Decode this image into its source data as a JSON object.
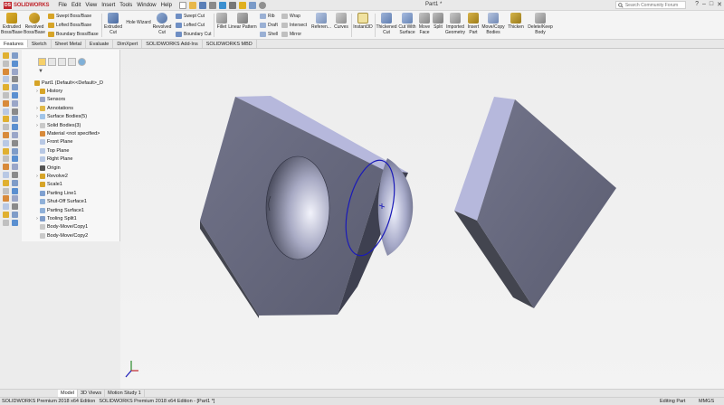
{
  "titlebar": {
    "brand": "SOLIDWORKS",
    "brand_mark": "DS",
    "menus": [
      "File",
      "Edit",
      "View",
      "Insert",
      "Tools",
      "Window",
      "Help"
    ],
    "document_title": "Part1 *",
    "search_placeholder": "Search Community Forum",
    "window_controls": [
      "?",
      "–",
      "□",
      "✕"
    ]
  },
  "ribbon": {
    "extruded_boss": "Extruded Boss/Base",
    "revolved_boss": "Revolved Boss/Base",
    "swept_boss": "Swept Boss/Base",
    "lofted_boss": "Lofted Boss/Base",
    "boundary_boss": "Boundary Boss/Base",
    "extruded_cut": "Extruded Cut",
    "hole_wizard": "Hole Wizard",
    "revolved_cut": "Revolved Cut",
    "swept_cut": "Swept Cut",
    "lofted_cut": "Lofted Cut",
    "boundary_cut": "Boundary Cut",
    "fillet": "Fillet",
    "linear_pattern": "Linear Pattern",
    "rib": "Rib",
    "draft": "Draft",
    "shell": "Shell",
    "wrap": "Wrap",
    "intersect": "Intersect",
    "mirror": "Mirror",
    "reference": "Referen...",
    "curves": "Curves",
    "instant3d": "Instant3D",
    "thickened_cut": "Thickened Cut",
    "cut_with_surface": "Cut With Surface",
    "move_face": "Move Face",
    "split": "Split",
    "imported_geometry": "Imported Geometry",
    "insert_part": "Insert Part",
    "move_copy_bodies": "Move/Copy Bodies",
    "thicken": "Thicken",
    "delete_keep_body": "Delete/Keep Body"
  },
  "cmd_tabs": [
    "Features",
    "Sketch",
    "Sheet Metal",
    "Evaluate",
    "DimXpert",
    "SOLIDWORKS Add-Ins",
    "SOLIDWORKS MBD"
  ],
  "feature_tree": {
    "root": "Part1  (Default<<Default>_D",
    "items": [
      {
        "label": "History",
        "expand": "›"
      },
      {
        "label": "Sensors",
        "expand": ""
      },
      {
        "label": "Annotations",
        "expand": "›"
      },
      {
        "label": "Surface Bodies(5)",
        "expand": "›"
      },
      {
        "label": "Solid Bodies(3)",
        "expand": "›"
      },
      {
        "label": "Material <not specified>",
        "expand": ""
      },
      {
        "label": "Front Plane",
        "expand": ""
      },
      {
        "label": "Top Plane",
        "expand": ""
      },
      {
        "label": "Right Plane",
        "expand": ""
      },
      {
        "label": "Origin",
        "expand": ""
      },
      {
        "label": "Revolve2",
        "expand": "›"
      },
      {
        "label": "Scale1",
        "expand": ""
      },
      {
        "label": "Parting Line1",
        "expand": ""
      },
      {
        "label": "Shut-Off Surface1",
        "expand": ""
      },
      {
        "label": "Parting Surface1",
        "expand": ""
      },
      {
        "label": "Tooling Split1",
        "expand": "›"
      },
      {
        "label": "Body-Move/Copy1",
        "expand": ""
      },
      {
        "label": "Body-Move/Copy2",
        "expand": ""
      }
    ]
  },
  "bottom_tabs": [
    "Model",
    "3D Views",
    "Motion Study 1"
  ],
  "status": {
    "left": "SOLIDWORKS Premium 2018 x64 Edition",
    "center": "SOLIDWORKS Premium 2018 x64 Edition - [Part1 *]",
    "mode": "Editing Part",
    "units": "MMGS"
  },
  "colors": {
    "brand_red": "#c0262d",
    "face_top": "#b7b9dc",
    "face_dark": "#4c4e5e",
    "face_front": "#65677a",
    "selection_blue": "#1a1ab8"
  }
}
